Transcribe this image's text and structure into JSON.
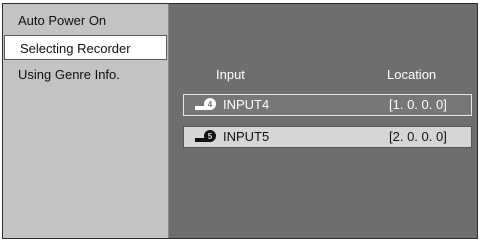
{
  "menu": {
    "items": [
      {
        "label": "Auto Power On"
      },
      {
        "label": "Selecting Recorder"
      },
      {
        "label": "Using Genre Info."
      }
    ]
  },
  "table": {
    "headers": {
      "input": "Input",
      "location": "Location"
    },
    "rows": [
      {
        "icon": "recorder-4-icon",
        "icon_number": "4",
        "input": "INPUT4",
        "location": "[1. 0. 0. 0]"
      },
      {
        "icon": "recorder-5-icon",
        "icon_number": "5",
        "input": "INPUT5",
        "location": "[2. 0. 0. 0]"
      }
    ]
  },
  "colors": {
    "panel": "#6e6e6e",
    "menu_bg": "#c3c3c3",
    "selected_bg": "#ffffff",
    "row_selected_bg": "#d6d6d6"
  }
}
